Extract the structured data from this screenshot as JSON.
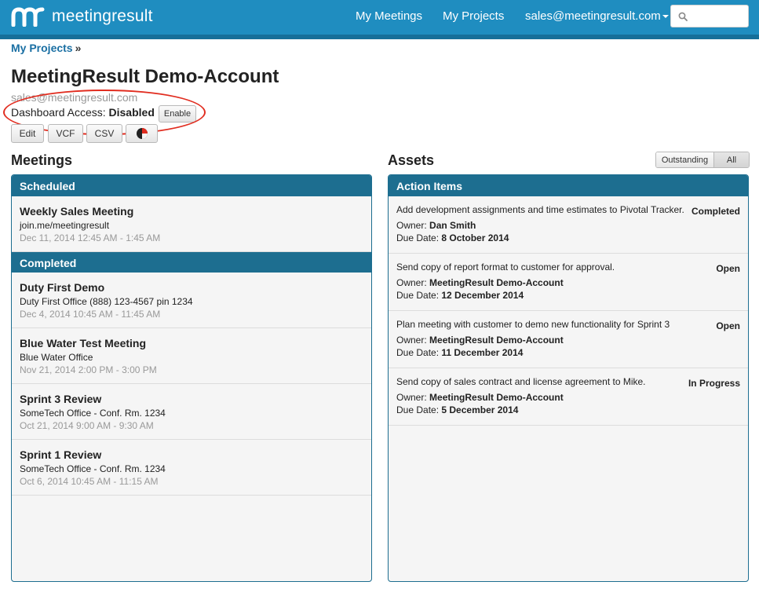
{
  "brand": {
    "name": "meetingresult"
  },
  "nav": {
    "my_meetings": "My Meetings",
    "my_projects": "My Projects",
    "account": "sales@meetingresult.com",
    "search_placeholder": ""
  },
  "breadcrumb": {
    "label": "My Projects",
    "sep": "»"
  },
  "project": {
    "title": "MeetingResult Demo-Account",
    "email": "sales@meetingresult.com",
    "dashboard_label": "Dashboard Access:",
    "dashboard_status": "Disabled",
    "enable_label": "Enable"
  },
  "toolbar": {
    "edit": "Edit",
    "vcf": "VCF",
    "csv": "CSV"
  },
  "meetings": {
    "heading": "Meetings",
    "scheduled_label": "Scheduled",
    "completed_label": "Completed",
    "scheduled": [
      {
        "title": "Weekly Sales Meeting",
        "location": "join.me/meetingresult",
        "time": "Dec 11, 2014 12:45 AM - 1:45 AM"
      }
    ],
    "completed": [
      {
        "title": "Duty First Demo",
        "location": "Duty First Office (888) 123-4567 pin 1234",
        "time": "Dec 4, 2014 10:45 AM - 11:45 AM"
      },
      {
        "title": "Blue Water Test Meeting",
        "location": "Blue Water Office",
        "time": "Nov 21, 2014 2:00 PM - 3:00 PM"
      },
      {
        "title": "Sprint 3 Review",
        "location": "SomeTech Office - Conf. Rm. 1234",
        "time": "Oct 21, 2014 9:00 AM - 9:30 AM"
      },
      {
        "title": "Sprint 1 Review",
        "location": "SomeTech Office - Conf. Rm. 1234",
        "time": "Oct 6, 2014 10:45 AM - 11:15 AM"
      }
    ]
  },
  "assets": {
    "heading": "Assets",
    "filter_outstanding": "Outstanding",
    "filter_all": "All",
    "action_items_label": "Action Items",
    "owner_label": "Owner:",
    "due_label": "Due Date:",
    "items": [
      {
        "description": "Add development assignments and time estimates to Pivotal Tracker.",
        "status": "Completed",
        "owner": "Dan Smith",
        "due": "8 October 2014"
      },
      {
        "description": "Send copy of report format to customer for approval.",
        "status": "Open",
        "owner": "MeetingResult Demo-Account",
        "due": "12 December 2014"
      },
      {
        "description": "Plan meeting with customer to demo new functionality for Sprint 3",
        "status": "Open",
        "owner": "MeetingResult Demo-Account",
        "due": "11 December 2014"
      },
      {
        "description": "Send copy of sales contract and license agreement to Mike.",
        "status": "In Progress",
        "owner": "MeetingResult Demo-Account",
        "due": "5 December 2014"
      }
    ]
  }
}
